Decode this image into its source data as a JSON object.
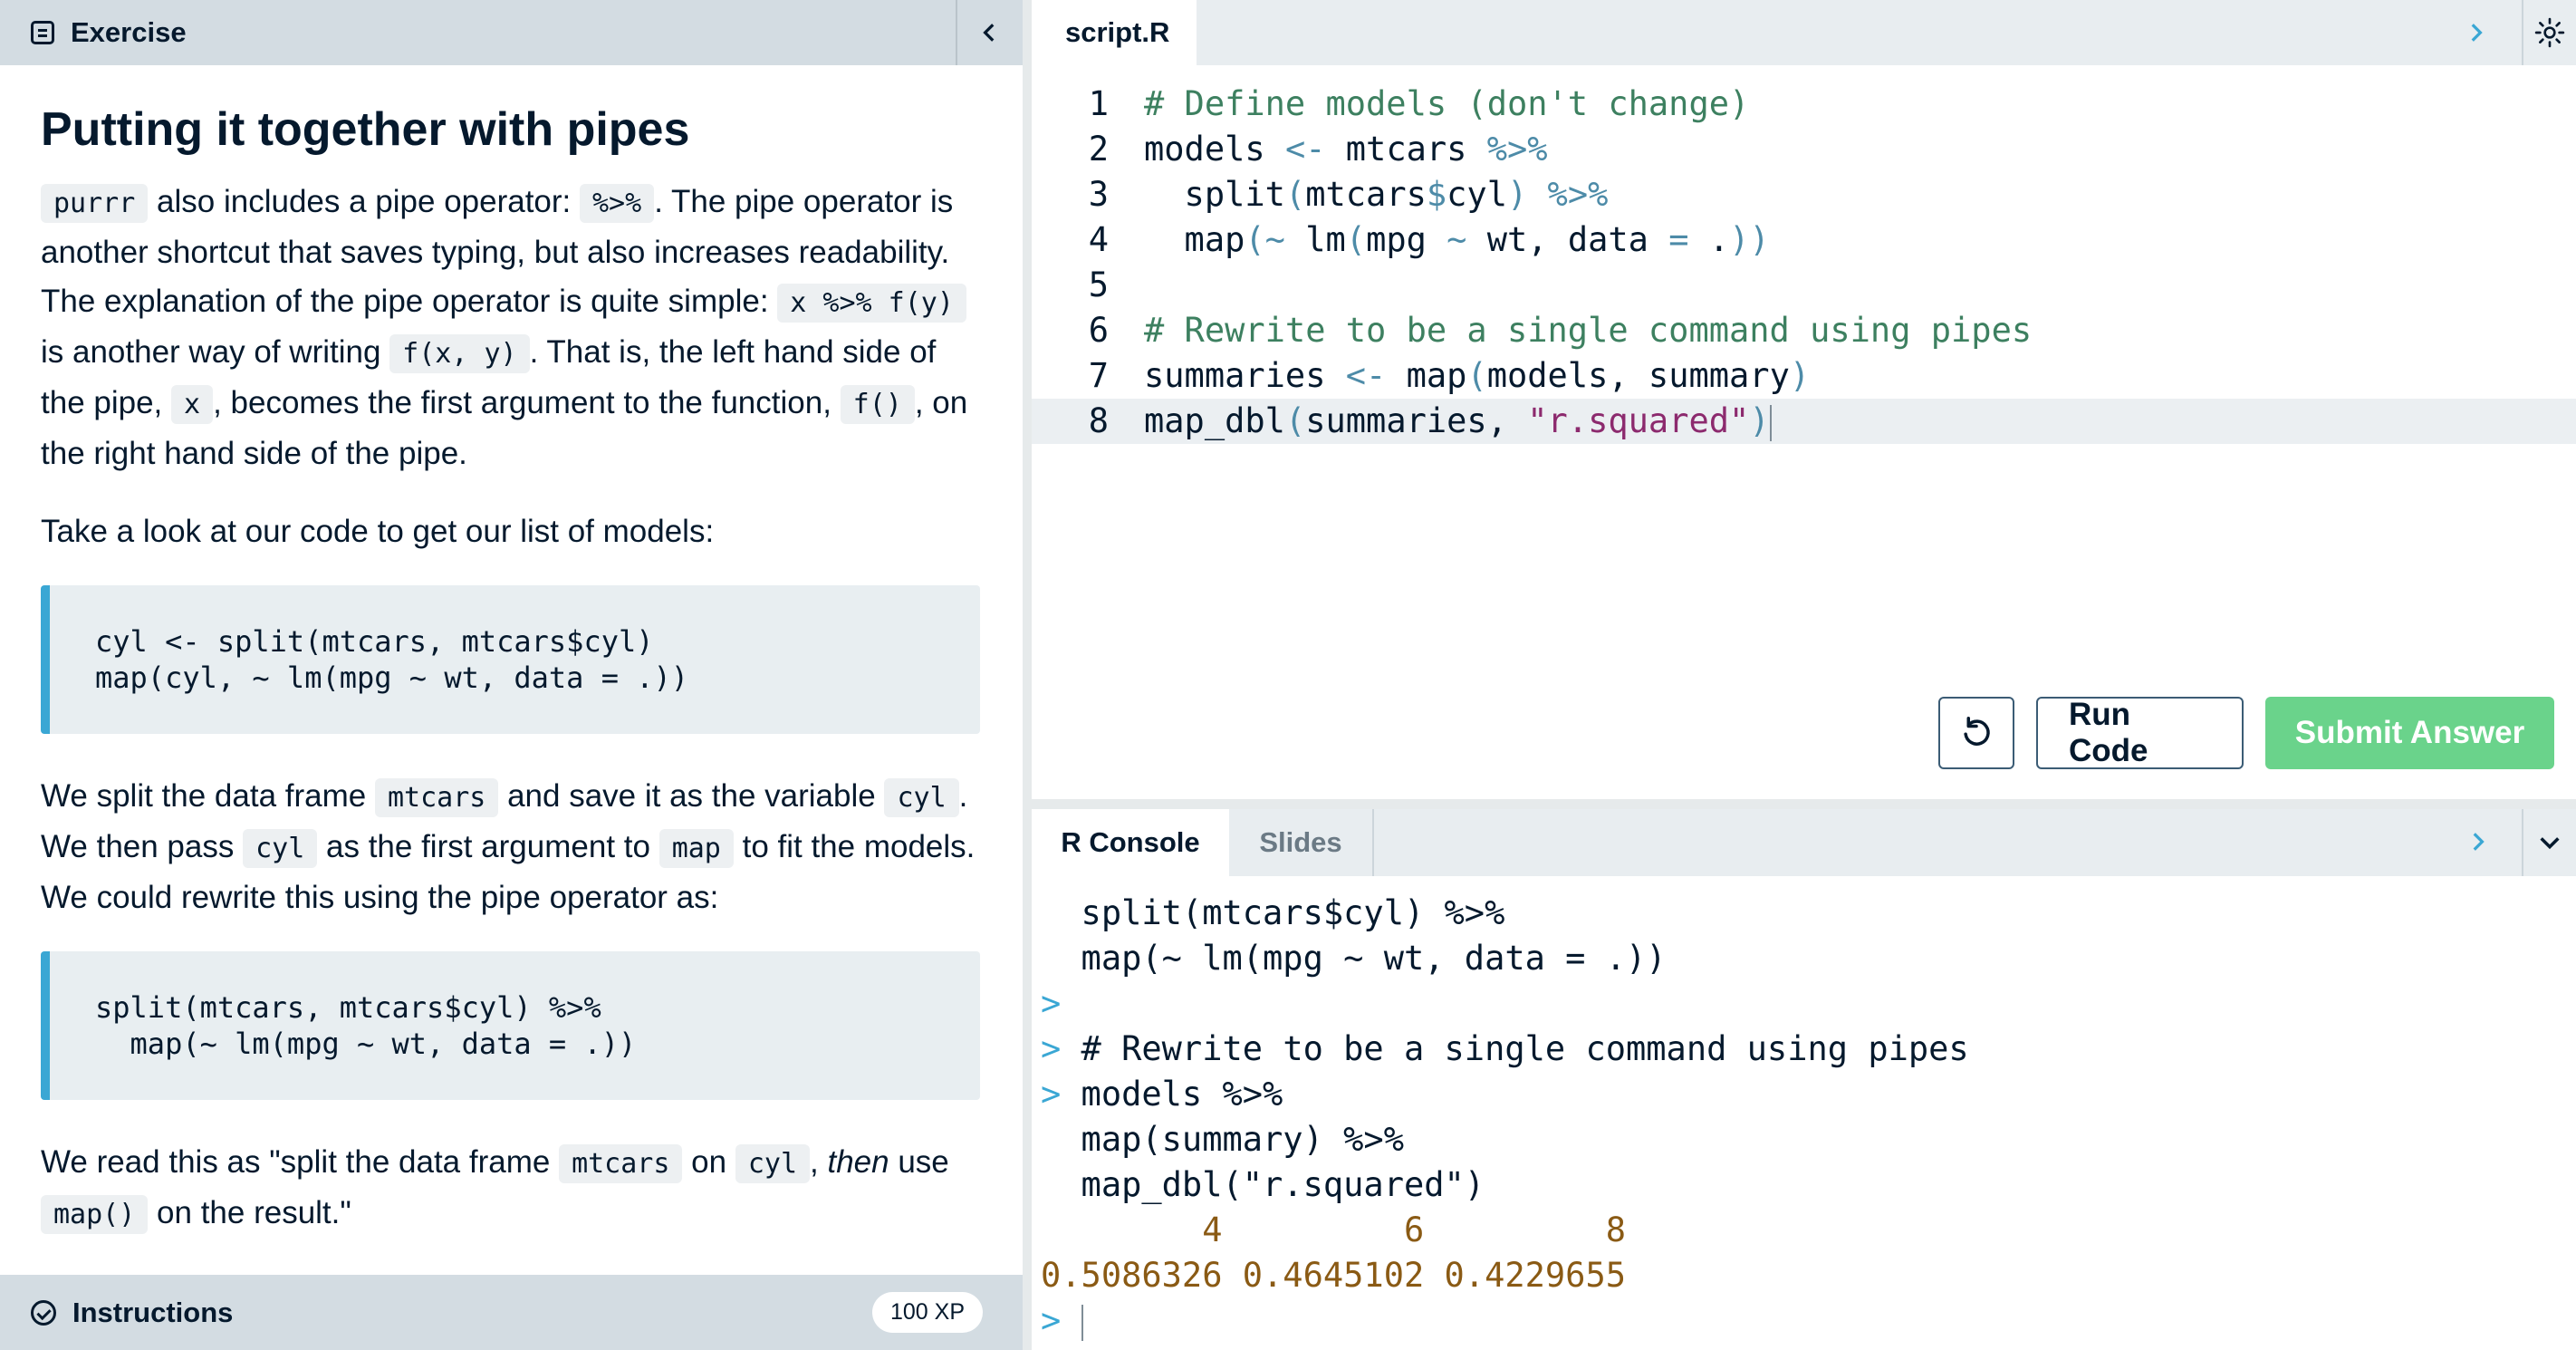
{
  "exercise_panel": {
    "header_label": "Exercise",
    "title": "Putting it together with pipes",
    "p1": {
      "c1": "purrr",
      "t1": " also includes a pipe operator: ",
      "c2": "%>%",
      "t2": ". The pipe operator is another shortcut that saves typing, but also increases readability. The explanation of the pipe operator is quite simple: ",
      "c3": "x %>% f(y)",
      "t3": " is another way of writing ",
      "c4": "f(x, y)",
      "t4": ". That is, the left hand side of the pipe, ",
      "c5": "x",
      "t5": ", becomes the first argument to the function, ",
      "c6": "f()",
      "t6": ", on the right hand side of the pipe."
    },
    "p2": "Take a look at our code to get our list of models:",
    "code_block_1": "cyl <- split(mtcars, mtcars$cyl)\nmap(cyl, ~ lm(mpg ~ wt, data = .))",
    "p3": {
      "t1": "We split the data frame ",
      "c1": "mtcars",
      "t2": " and save it as the variable ",
      "c2": "cyl",
      "t3": ". We then pass ",
      "c3": "cyl",
      "t4": " as the first argument to ",
      "c4": "map",
      "t5": " to fit the models. We could rewrite this using the pipe operator as:"
    },
    "code_block_2": "split(mtcars, mtcars$cyl) %>%\n  map(~ lm(mpg ~ wt, data = .))",
    "p4": {
      "t1": "We read this as \"split the data frame ",
      "c1": "mtcars",
      "t2": " on ",
      "c2": "cyl",
      "t3": ", ",
      "em": "then",
      "t4": " use ",
      "c3": "map()",
      "t5": " on the result.\""
    },
    "instructions_label": "Instructions",
    "xp_badge": "100 XP"
  },
  "editor": {
    "file_tab": "script.R",
    "line_numbers": [
      "1",
      "2",
      "3",
      "4",
      "5",
      "6",
      "7",
      "8"
    ],
    "lines": [
      [
        {
          "t": "# Define models (don't change)",
          "k": "comment"
        }
      ],
      [
        {
          "t": "models ",
          "k": "plain"
        },
        {
          "t": "<-",
          "k": "op"
        },
        {
          "t": " mtcars ",
          "k": "plain"
        },
        {
          "t": "%>%",
          "k": "op"
        }
      ],
      [
        {
          "t": "  split",
          "k": "plain"
        },
        {
          "t": "(",
          "k": "op"
        },
        {
          "t": "mtcars",
          "k": "plain"
        },
        {
          "t": "$",
          "k": "op"
        },
        {
          "t": "cyl",
          "k": "plain"
        },
        {
          "t": ")",
          "k": "op"
        },
        {
          "t": " ",
          "k": "plain"
        },
        {
          "t": "%>%",
          "k": "op"
        }
      ],
      [
        {
          "t": "  map",
          "k": "plain"
        },
        {
          "t": "(~",
          "k": "op"
        },
        {
          "t": " lm",
          "k": "plain"
        },
        {
          "t": "(",
          "k": "op"
        },
        {
          "t": "mpg ",
          "k": "plain"
        },
        {
          "t": "~",
          "k": "op"
        },
        {
          "t": " wt, data ",
          "k": "plain"
        },
        {
          "t": "=",
          "k": "op"
        },
        {
          "t": " .",
          "k": "plain"
        },
        {
          "t": "))",
          "k": "op"
        }
      ],
      [],
      [
        {
          "t": "# Rewrite to be a single command using pipes",
          "k": "comment"
        }
      ],
      [
        {
          "t": "summaries ",
          "k": "plain"
        },
        {
          "t": "<-",
          "k": "op"
        },
        {
          "t": " map",
          "k": "plain"
        },
        {
          "t": "(",
          "k": "op"
        },
        {
          "t": "models, summary",
          "k": "plain"
        },
        {
          "t": ")",
          "k": "op"
        }
      ],
      [
        {
          "t": "map_dbl",
          "k": "plain"
        },
        {
          "t": "(",
          "k": "op"
        },
        {
          "t": "summaries, ",
          "k": "plain"
        },
        {
          "t": "\"r.squared\"",
          "k": "str"
        },
        {
          "t": ")",
          "k": "op"
        }
      ]
    ],
    "active_line": 8,
    "run_label": "Run Code",
    "submit_label": "Submit Answer"
  },
  "console": {
    "tabs": [
      "R Console",
      "Slides"
    ],
    "lines": [
      {
        "prompt": "",
        "text": "  split(mtcars$cyl) %>%",
        "k": "plain"
      },
      {
        "prompt": "",
        "text": "  map(~ lm(mpg ~ wt, data = .))",
        "k": "plain"
      },
      {
        "prompt": ">",
        "text": "",
        "k": "plain"
      },
      {
        "prompt": ">",
        "text": " # Rewrite to be a single command using pipes",
        "k": "plain"
      },
      {
        "prompt": ">",
        "text": " models %>%",
        "k": "plain"
      },
      {
        "prompt": "",
        "text": "  map(summary) %>%",
        "k": "plain"
      },
      {
        "prompt": "",
        "text": "  map_dbl(\"r.squared\")",
        "k": "plain"
      },
      {
        "prompt": "",
        "text": "        4         6         8",
        "k": "out"
      },
      {
        "prompt": "",
        "text": "0.5086326 0.4645102 0.4229655",
        "k": "out"
      },
      {
        "prompt": ">",
        "text": " ",
        "k": "cursor"
      }
    ]
  },
  "colors": {
    "accent_blue": "#3aa7d4",
    "submit_green": "#6ad38b",
    "header_gray": "#d3dce2"
  }
}
